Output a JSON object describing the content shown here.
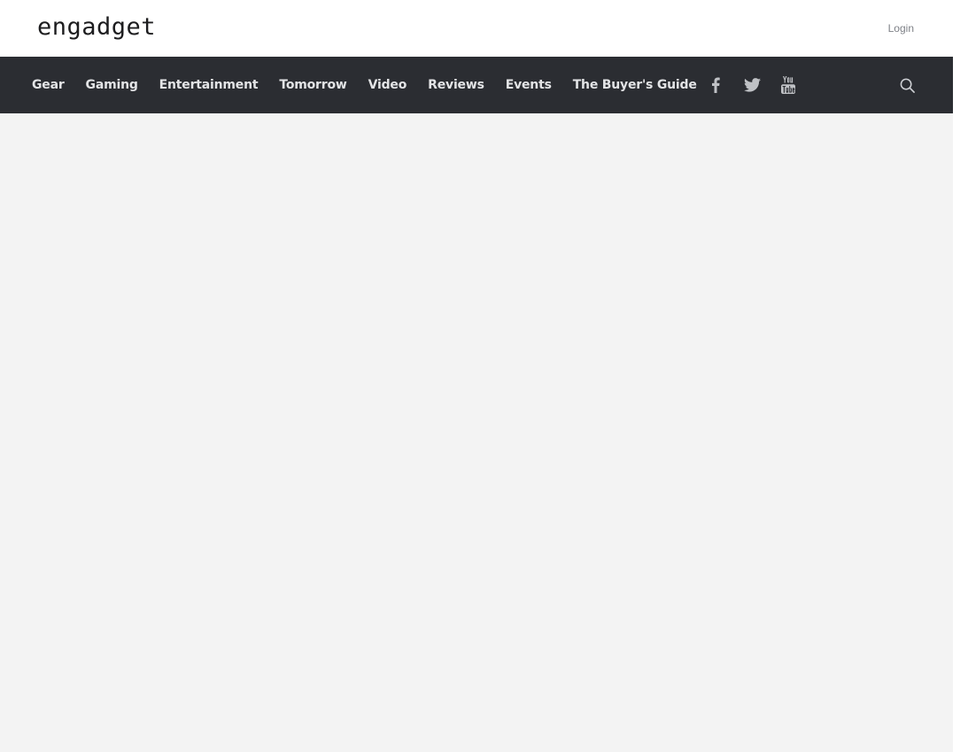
{
  "header": {
    "logo_text": "engadget",
    "login_label": "Login"
  },
  "nav": {
    "items": [
      {
        "label": "Gear"
      },
      {
        "label": "Gaming"
      },
      {
        "label": "Entertainment"
      },
      {
        "label": "Tomorrow"
      },
      {
        "label": "Video"
      },
      {
        "label": "Reviews"
      },
      {
        "label": "Events"
      },
      {
        "label": "The Buyer's Guide"
      }
    ],
    "social": [
      "facebook-icon",
      "twitter-icon",
      "youtube-icon"
    ],
    "search_icon": "search-icon"
  },
  "colors": {
    "navbar_bg": "#2b2d32",
    "content_bg": "#f3f3f3",
    "nav_text": "#e3e4e6"
  }
}
